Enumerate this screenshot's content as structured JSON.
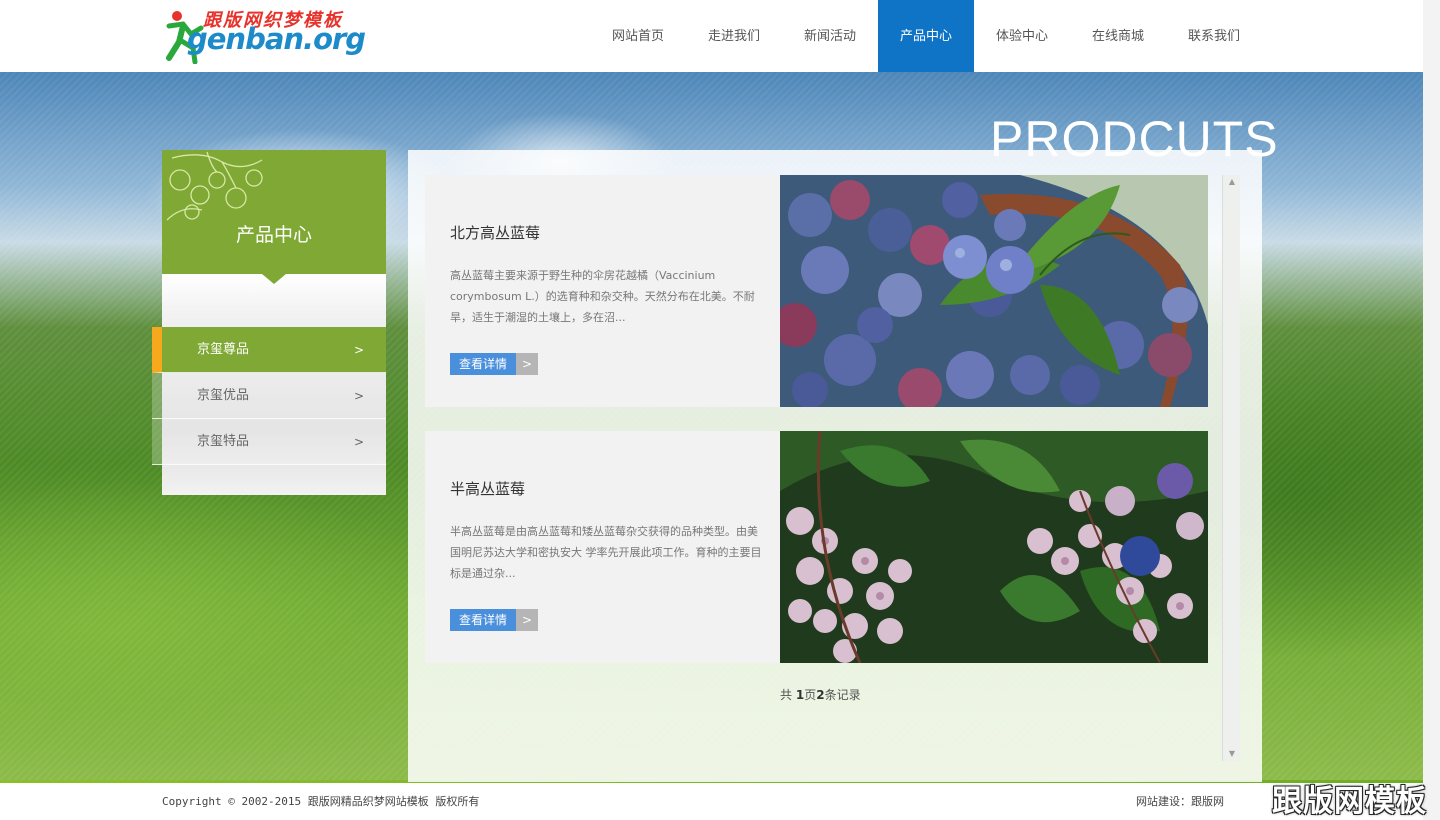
{
  "logo": {
    "cn": "跟版网织梦模板",
    "en": "genban.org"
  },
  "nav": {
    "items": [
      {
        "label": "网站首页"
      },
      {
        "label": "走进我们"
      },
      {
        "label": "新闻活动"
      },
      {
        "label": "产品中心",
        "active": true
      },
      {
        "label": "体验中心"
      },
      {
        "label": "在线商城"
      },
      {
        "label": "联系我们"
      }
    ]
  },
  "section_title": "PRODCUTS",
  "sidebar": {
    "title": "产品中心",
    "items": [
      {
        "label": "京玺尊品",
        "chevron": ">",
        "active": true
      },
      {
        "label": "京玺优品",
        "chevron": ">"
      },
      {
        "label": "京玺特品",
        "chevron": ">"
      }
    ]
  },
  "products": [
    {
      "title": "北方高丛蓝莓",
      "desc": "高丛蓝莓主要来源于野生种的伞房花越橘（Vaccinium corymbosum L.）的选育种和杂交种。天然分布在北美。不耐旱，适生于潮湿的土壤上，多在沼...",
      "button": "查看详情",
      "arrow": ">"
    },
    {
      "title": "半高丛蓝莓",
      "desc": "半高丛蓝莓是由高丛蓝莓和矮丛蓝莓杂交获得的品种类型。由美国明尼苏达大学和密执安大 学率先开展此项工作。育种的主要目标是通过杂...",
      "button": "查看详情",
      "arrow": ">"
    }
  ],
  "pagination": {
    "prefix": "共 ",
    "pages": "1",
    "mid": "页",
    "records": "2",
    "suffix": "条记录"
  },
  "footer": {
    "copyright": "Copyright © 2002-2015 跟版网精品织梦网站模板 版权所有",
    "build": "网站建设：跟版网"
  },
  "watermark": "跟版网模板",
  "colors": {
    "nav_active": "#0f74c5",
    "green": "#7fa834",
    "orange": "#f7a91e",
    "button": "#4a8fdb"
  }
}
